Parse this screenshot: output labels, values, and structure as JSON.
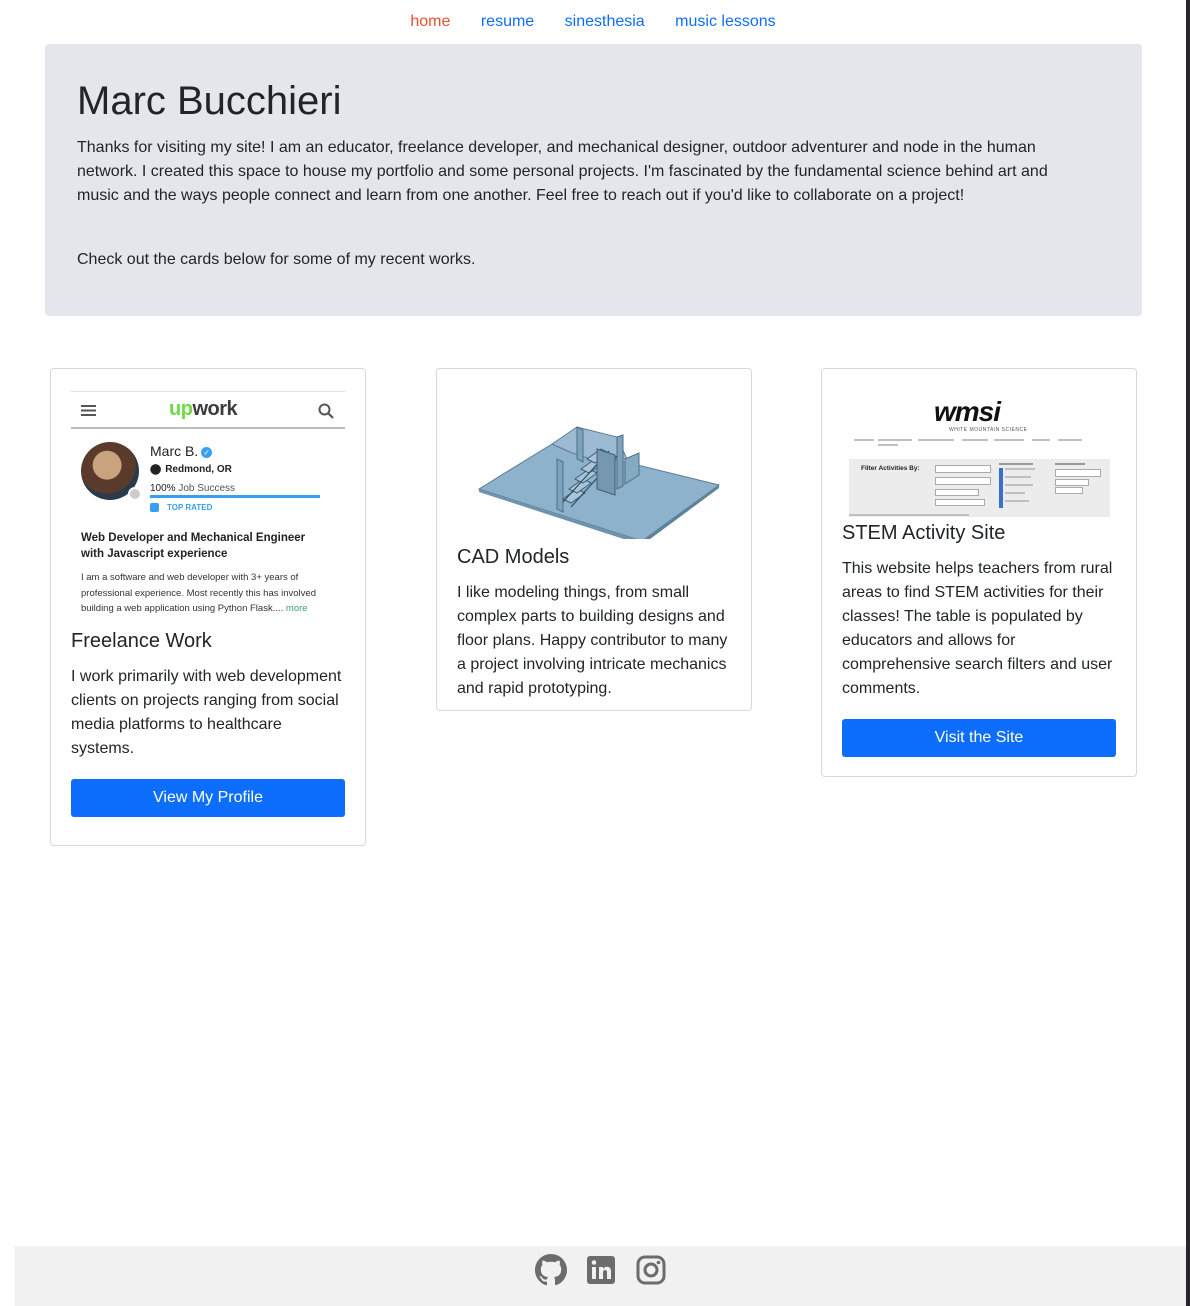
{
  "nav": {
    "items": [
      {
        "label": "home",
        "active": true
      },
      {
        "label": "resume",
        "active": false
      },
      {
        "label": "sinesthesia",
        "active": false
      },
      {
        "label": "music lessons",
        "active": false
      }
    ]
  },
  "hero": {
    "title": "Marc Bucchieri",
    "intro": "Thanks for visiting my site! I am an educator, freelance developer, and mechanical designer, outdoor adventurer and node in the human network. I created this space to house my portfolio and some personal projects. I'm fascinated by the fundamental science behind art and music and the ways people connect and learn from one another. Feel free to reach out if you'd like to collaborate on a project!",
    "cta_text": "Check out the cards below for some of my recent works."
  },
  "cards": [
    {
      "title": "Freelance Work",
      "text": "I work primarily with web development clients on projects ranging from social media platforms to healthcare systems.",
      "button": "View My Profile",
      "image": {
        "logo_up": "up",
        "logo_rest": "work",
        "name": "Marc B.",
        "location": "Redmond, OR",
        "job_success_pct": "100%",
        "job_success_label": "Job Success",
        "badge": "TOP RATED",
        "headline": "Web Developer and Mechanical Engineer with Javascript experience",
        "description": "I am a software and web developer with 3+ years of professional experience. Most recently this has involved building a web application using Python Flask....",
        "more": "more"
      }
    },
    {
      "title": "CAD Models",
      "text": "I like modeling things, from small complex parts to building designs and floor plans. Happy contributor to many a project involving intricate mechanics and rapid prototyping.",
      "image": {
        "icon": "cad-floorplan-render"
      }
    },
    {
      "title": "STEM Activity Site",
      "text": "This website helps teachers from rural areas to find STEM activities for their classes! The table is populated by educators and allows for comprehensive search filters and user comments.",
      "button": "Visit the Site",
      "image": {
        "logo": "wmsi",
        "subtitle": "WHITE MOUNTAIN SCIENCE",
        "filter_label": "Filter Activities By:"
      }
    }
  ],
  "footer": {
    "icons": [
      "github-icon",
      "linkedin-icon",
      "instagram-icon"
    ],
    "icon_color": "#6c6c6c"
  },
  "colors": {
    "link": "#0d6efd",
    "active_link": "#e8512b",
    "button": "#0d6efd",
    "hero_bg": "#e4e6eb"
  }
}
